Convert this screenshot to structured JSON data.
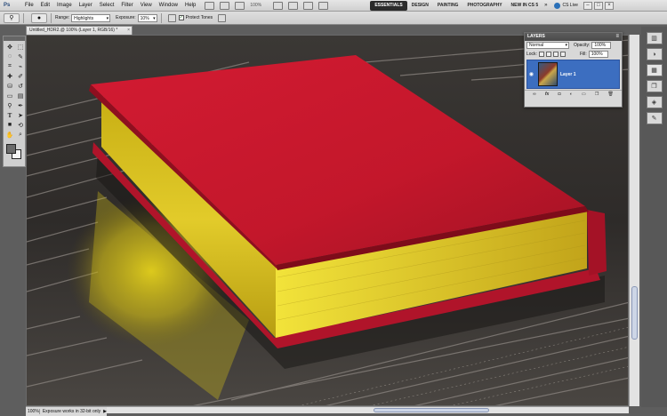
{
  "menubar": {
    "logo": "Ps",
    "items": [
      "File",
      "Edit",
      "Image",
      "Layer",
      "Select",
      "Filter",
      "View",
      "Window",
      "Help"
    ],
    "zoom": "100%",
    "workspaces": [
      "ESSENTIALS",
      "DESIGN",
      "PAINTING",
      "PHOTOGRAPHY",
      "NEW IN CS 5"
    ],
    "active_workspace": "ESSENTIALS",
    "cs_live": "CS Live",
    "win_buttons": [
      "–",
      "□",
      "×"
    ]
  },
  "options": {
    "range_label": "Range:",
    "range_value": "Highlights",
    "exposure_label": "Exposure:",
    "exposure_value": "10%",
    "protect_tones_label": "Protect Tones",
    "protect_tones_checked": true
  },
  "document": {
    "tab_title": "Untitled_HDR2.@ 100% (Layer 1, RGB/16) *",
    "close": "×"
  },
  "status": {
    "zoom": "100%",
    "text": "Exposure works in 32-bit only",
    "arrow": "▶"
  },
  "layers_panel": {
    "title": "LAYERS",
    "blend_mode": "Normal",
    "opacity_label": "Opacity:",
    "opacity_value": "100%",
    "lock_label": "Lock:",
    "fill_label": "Fill:",
    "fill_value": "100%",
    "layers": [
      {
        "name": "Layer 1",
        "visible": true,
        "selected": true
      }
    ],
    "footer_icons": [
      "link-icon",
      "fx-icon",
      "mask-icon",
      "adjustment-icon",
      "group-icon",
      "new-layer-icon",
      "trash-icon"
    ]
  },
  "colors": {
    "accent": "#3c6ec0",
    "book_cover": "#c41a2c",
    "page_edge": "#d9c420",
    "workspace_active": "#2b2b2b"
  },
  "toolbox": {
    "tools": [
      "move-tool",
      "marquee-tool",
      "lasso-tool",
      "quick-selection-tool",
      "crop-tool",
      "eyedropper-tool",
      "healing-brush-tool",
      "brush-tool",
      "clone-stamp-tool",
      "history-brush-tool",
      "eraser-tool",
      "gradient-tool",
      "dodge-tool",
      "pen-tool",
      "type-tool",
      "path-selection-tool",
      "shape-tool",
      "3d-tool",
      "hand-tool",
      "zoom-tool"
    ]
  }
}
